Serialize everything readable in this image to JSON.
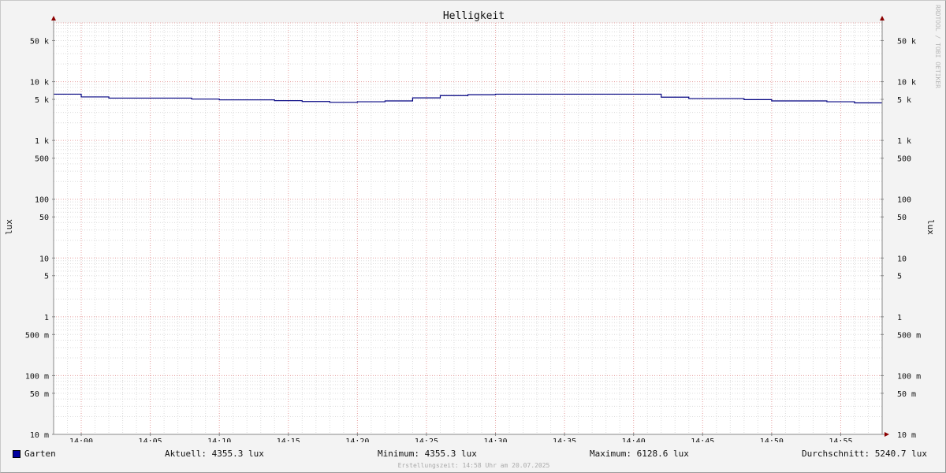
{
  "chart_data": {
    "type": "line",
    "title": "Helligkeit",
    "ylabel": "lux",
    "ylabel_right": "lux",
    "y_scale": "log",
    "ylim": [
      0.01,
      100000
    ],
    "y_ticks": [
      {
        "value": 50000,
        "label": "50 k"
      },
      {
        "value": 10000,
        "label": "10 k"
      },
      {
        "value": 5000,
        "label": "5 k"
      },
      {
        "value": 1000,
        "label": "1 k"
      },
      {
        "value": 500,
        "label": "500"
      },
      {
        "value": 100,
        "label": "100"
      },
      {
        "value": 50,
        "label": "50"
      },
      {
        "value": 10,
        "label": "10"
      },
      {
        "value": 5,
        "label": "5"
      },
      {
        "value": 1,
        "label": "1"
      },
      {
        "value": 0.5,
        "label": "500 m"
      },
      {
        "value": 0.1,
        "label": "100 m"
      },
      {
        "value": 0.05,
        "label": "50 m"
      },
      {
        "value": 0.01,
        "label": "10 m"
      }
    ],
    "x_range": [
      "13:58",
      "14:58"
    ],
    "x_ticks": [
      "14:00",
      "14:05",
      "14:10",
      "14:15",
      "14:20",
      "14:25",
      "14:30",
      "14:35",
      "14:40",
      "14:45",
      "14:50",
      "14:55"
    ],
    "grid": true,
    "series": [
      {
        "name": "Garten",
        "color": "#000080",
        "step": true,
        "x": [
          "13:58",
          "14:00",
          "14:02",
          "14:04",
          "14:06",
          "14:08",
          "14:10",
          "14:12",
          "14:14",
          "14:16",
          "14:18",
          "14:20",
          "14:22",
          "14:24",
          "14:26",
          "14:28",
          "14:30",
          "14:32",
          "14:34",
          "14:36",
          "14:38",
          "14:40",
          "14:42",
          "14:44",
          "14:46",
          "14:48",
          "14:50",
          "14:52",
          "14:54",
          "14:56",
          "14:58"
        ],
        "values": [
          6128.6,
          5500,
          5250,
          5250,
          5250,
          5050,
          4900,
          4900,
          4750,
          4600,
          4450,
          4550,
          4700,
          5300,
          5800,
          6000,
          6128.6,
          6128.6,
          6128.6,
          6128.6,
          6128.6,
          6128.6,
          5450,
          5150,
          5150,
          4950,
          4700,
          4700,
          4550,
          4355.3,
          4355.3
        ]
      }
    ]
  },
  "legend": {
    "series_name": "Garten",
    "current": "Aktuell: 4355.3 lux",
    "minimum": "Minimum: 4355.3 lux",
    "maximum": "Maximum: 6128.6 lux",
    "average": "Durchschnitt: 5240.7 lux",
    "swatch_color": "#0000a0"
  },
  "watermark": "RRDTOOL / TOBI OETIKER",
  "credit": "Erstellungszeit: 14:58 Uhr am 20.07.2025"
}
